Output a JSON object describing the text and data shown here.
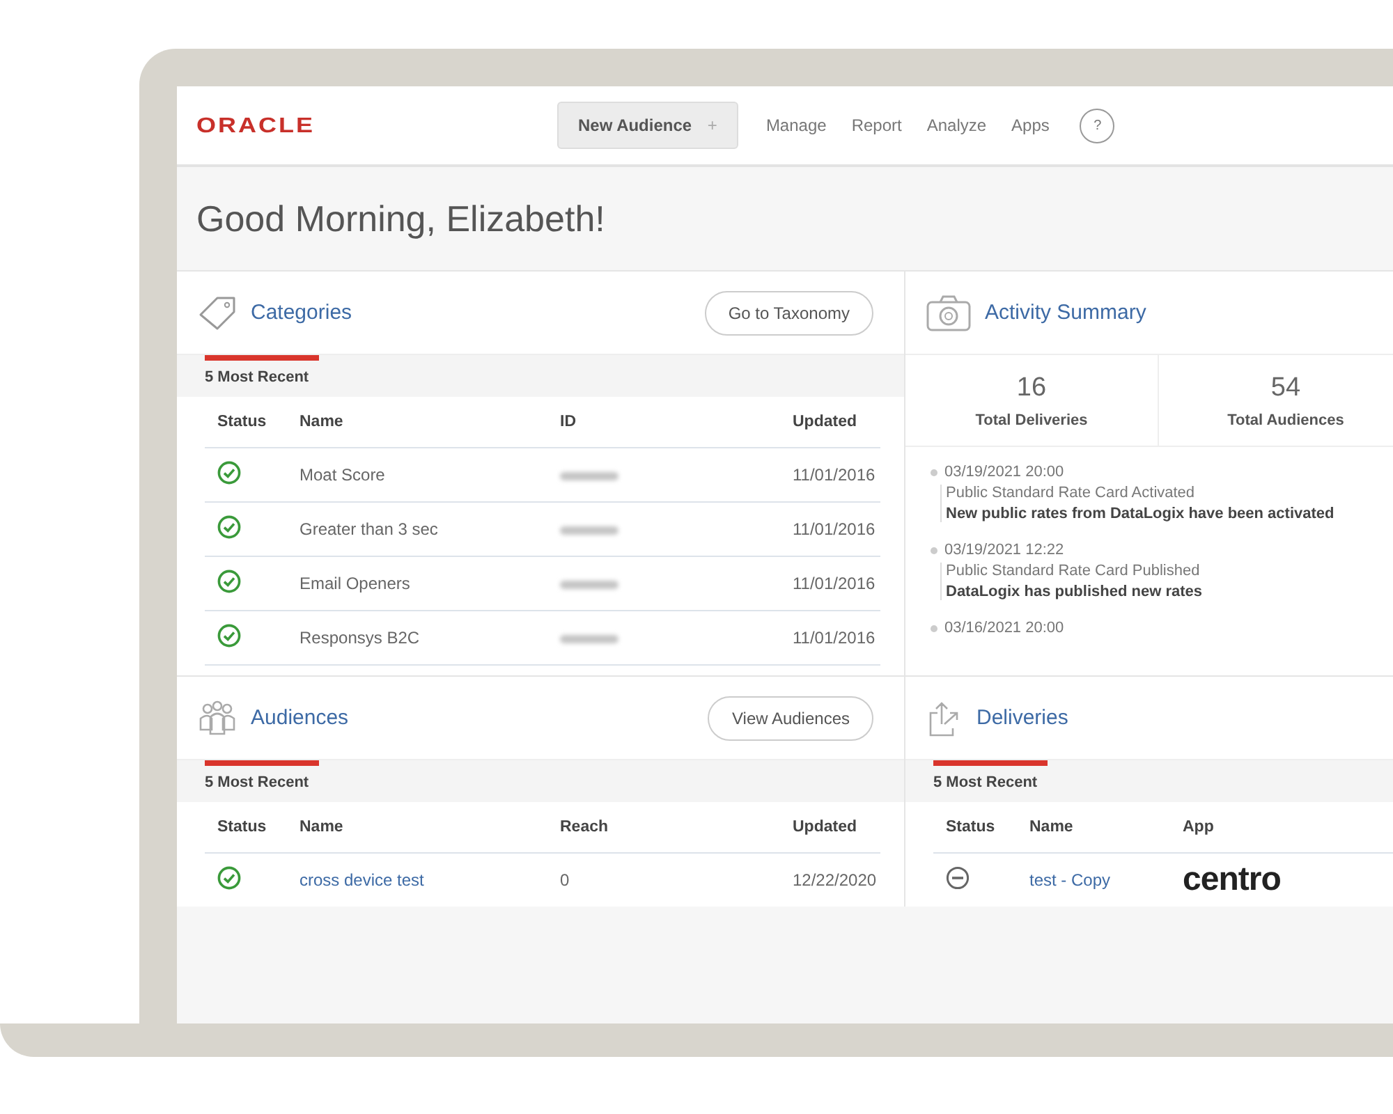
{
  "header": {
    "logo": "ORACLE",
    "primary_button": "New Audience",
    "primary_button_icon": "+",
    "nav": [
      "Manage",
      "Report",
      "Analyze",
      "Apps"
    ],
    "help": "?"
  },
  "greeting": "Good Morning, Elizabeth!",
  "categories": {
    "title": "Categories",
    "button": "Go to Taxonomy",
    "subtitle": "5 Most Recent",
    "columns": [
      "Status",
      "Name",
      "ID",
      "Updated"
    ],
    "rows": [
      {
        "active": true,
        "name": "Moat Score",
        "updated": "11/01/2016"
      },
      {
        "active": true,
        "name": "Greater than 3 sec",
        "updated": "11/01/2016"
      },
      {
        "active": true,
        "name": "Email Openers",
        "updated": "11/01/2016"
      },
      {
        "active": true,
        "name": "Responsys B2C",
        "updated": "11/01/2016"
      }
    ]
  },
  "activity": {
    "title": "Activity Summary",
    "stats": [
      {
        "value": "16",
        "label": "Total Deliveries"
      },
      {
        "value": "54",
        "label": "Total Audiences"
      }
    ],
    "events": [
      {
        "time": "03/19/2021 20:00",
        "title": "Public Standard Rate Card Activated",
        "detail": "New public rates from DataLogix have been activated"
      },
      {
        "time": "03/19/2021 12:22",
        "title": "Public Standard Rate Card Published",
        "detail": "DataLogix has published new rates"
      },
      {
        "time": "03/16/2021 20:00"
      }
    ]
  },
  "audiences": {
    "title": "Audiences",
    "button": "View Audiences",
    "subtitle": "5 Most Recent",
    "columns": [
      "Status",
      "Name",
      "Reach",
      "Updated"
    ],
    "rows": [
      {
        "active": true,
        "name": "cross device test",
        "reach": "0",
        "updated": "12/22/2020"
      }
    ]
  },
  "deliveries": {
    "title": "Deliveries",
    "subtitle": "5 Most Recent",
    "columns": [
      "Status",
      "Name",
      "App"
    ],
    "rows": [
      {
        "active": false,
        "name": "test - Copy",
        "app": "centro"
      }
    ]
  }
}
